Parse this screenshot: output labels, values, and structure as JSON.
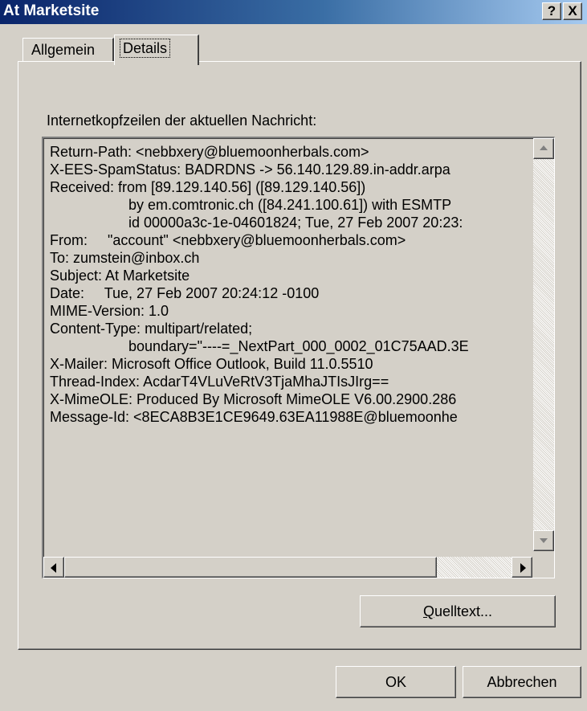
{
  "window": {
    "title": "At Marketsite",
    "help_button": "?",
    "close_button": "X"
  },
  "tabs": [
    {
      "label": "Allgemein"
    },
    {
      "label": "Details"
    }
  ],
  "panel": {
    "label": "Internetkopfzeilen der aktuellen Nachricht:",
    "header_lines": [
      "Return-Path: <nebbxery@bluemoonherbals.com>",
      "X-EES-SpamStatus: BADRDNS -> 56.140.129.89.in-addr.arpa",
      "Received: from [89.129.140.56] ([89.129.140.56])",
      "by em.comtronic.ch ([84.241.100.61]) with ESMTP",
      "id 00000a3c-1e-04601824; Tue, 27 Feb 2007 20:23:",
      "From:     \"account\" <nebbxery@bluemoonherbals.com>",
      "To: zumstein@inbox.ch",
      "Subject: At Marketsite",
      "Date:     Tue, 27 Feb 2007 20:24:12 -0100",
      "MIME-Version: 1.0",
      "Content-Type: multipart/related;",
      "boundary=\"----=_NextPart_000_0002_01C75AAD.3E",
      "X-Mailer: Microsoft Office Outlook, Build 11.0.5510",
      "Thread-Index: AcdarT4VLuVeRtV3TjaMhaJTIsJIrg==",
      "X-MimeOLE: Produced By Microsoft MimeOLE V6.00.2900.286",
      "Message-Id: <8ECA8B3E1CE9649.63EA11988E@bluemoonhe"
    ],
    "source_button": {
      "accel": "Q",
      "rest": "uelltext..."
    }
  },
  "footer": {
    "ok_label": "OK",
    "cancel_label": "Abbrechen"
  }
}
